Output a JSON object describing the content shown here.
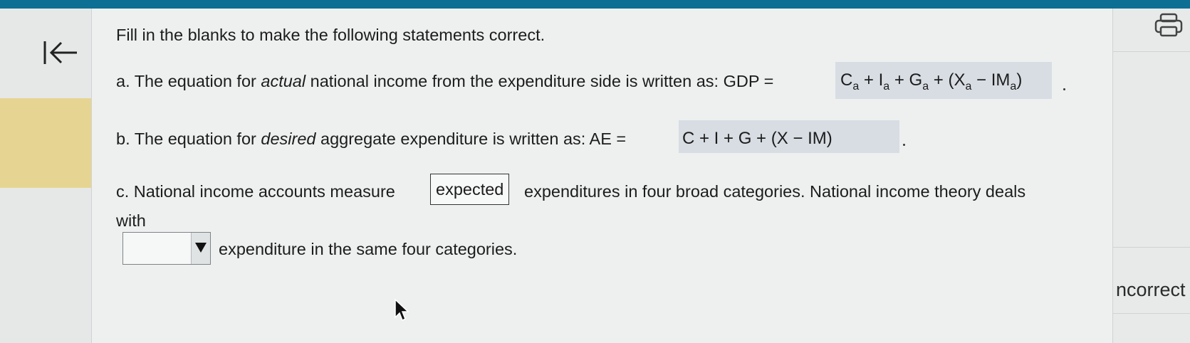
{
  "instruction": "Fill in the blanks to make the following statements correct.",
  "statement_a": {
    "prefix": "a. The equation for ",
    "emphasis": "actual",
    "suffix": " national income from the expenditure side is written as: GDP =",
    "answer": {
      "C": "C",
      "C_sub": "a",
      "I": "I",
      "I_sub": "a",
      "G": "G",
      "G_sub": "a",
      "X": "X",
      "X_sub": "a",
      "IM": "IM",
      "IM_sub": "a"
    }
  },
  "statement_b": {
    "prefix": "b. The equation for ",
    "emphasis": "desired",
    "suffix": " aggregate expenditure is written as: AE =",
    "answer": "C + I + G + (X − IM)"
  },
  "statement_c": {
    "part1": "c. National income accounts measure",
    "selected_answer": "expected",
    "part2": "expenditures in four broad categories. National income theory deals",
    "part3": "with",
    "dropdown_value": "",
    "part4": "expenditure in the same four categories."
  },
  "right_panel": {
    "feedback_text": "ncorrect"
  },
  "icons": {
    "back": "back-to-start-icon",
    "print": "print-icon",
    "dropdown": "triangle-down-icon",
    "cursor": "mouse-cursor-icon"
  },
  "colors": {
    "top_bar": "#0d6f93",
    "accent": "#e6d592",
    "answer_highlight": "#d7dde3"
  }
}
